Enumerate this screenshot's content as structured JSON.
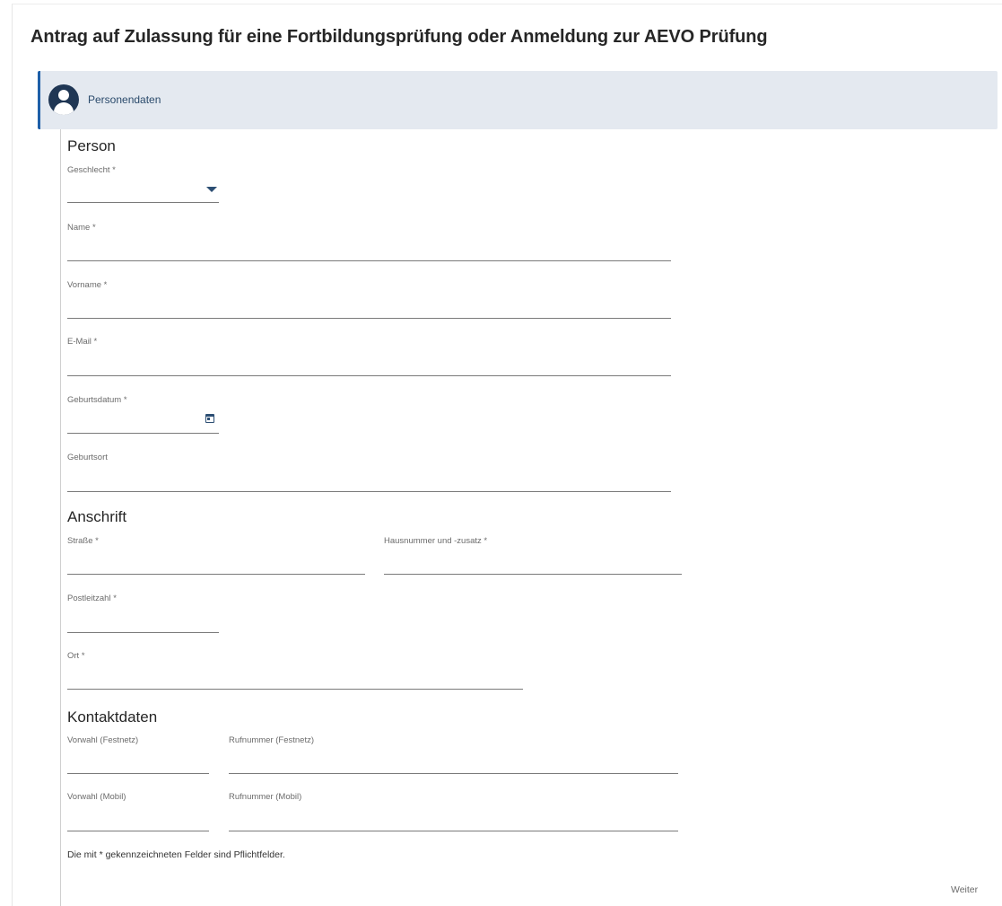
{
  "page": {
    "title": "Antrag auf Zulassung für eine Fortbildungsprüfung oder Anmeldung zur AEVO Prüfung"
  },
  "step": {
    "label": "Personendaten",
    "icon": "person-icon",
    "accent": "#1e5fa8"
  },
  "sections": {
    "person": {
      "title": "Person",
      "gender_label": "Geschlecht *",
      "gender_value": "",
      "name_label": "Name *",
      "firstname_label": "Vorname *",
      "email_label": "E-Mail *",
      "birthdate_label": "Geburtsdatum *",
      "birthplace_label": "Geburtsort"
    },
    "address": {
      "title": "Anschrift",
      "street_label": "Straße *",
      "housenumber_label": "Hausnummer und -zusatz *",
      "zip_label": "Postleitzahl *",
      "city_label": "Ort *"
    },
    "contact": {
      "title": "Kontaktdaten",
      "landline_area_label": "Vorwahl (Festnetz)",
      "landline_number_label": "Rufnummer (Festnetz)",
      "mobile_area_label": "Vorwahl (Mobil)",
      "mobile_number_label": "Rufnummer (Mobil)"
    }
  },
  "footer": {
    "required_note": "Die mit * gekennzeichneten Felder sind Pflichtfelder.",
    "next_label": "Weiter"
  }
}
